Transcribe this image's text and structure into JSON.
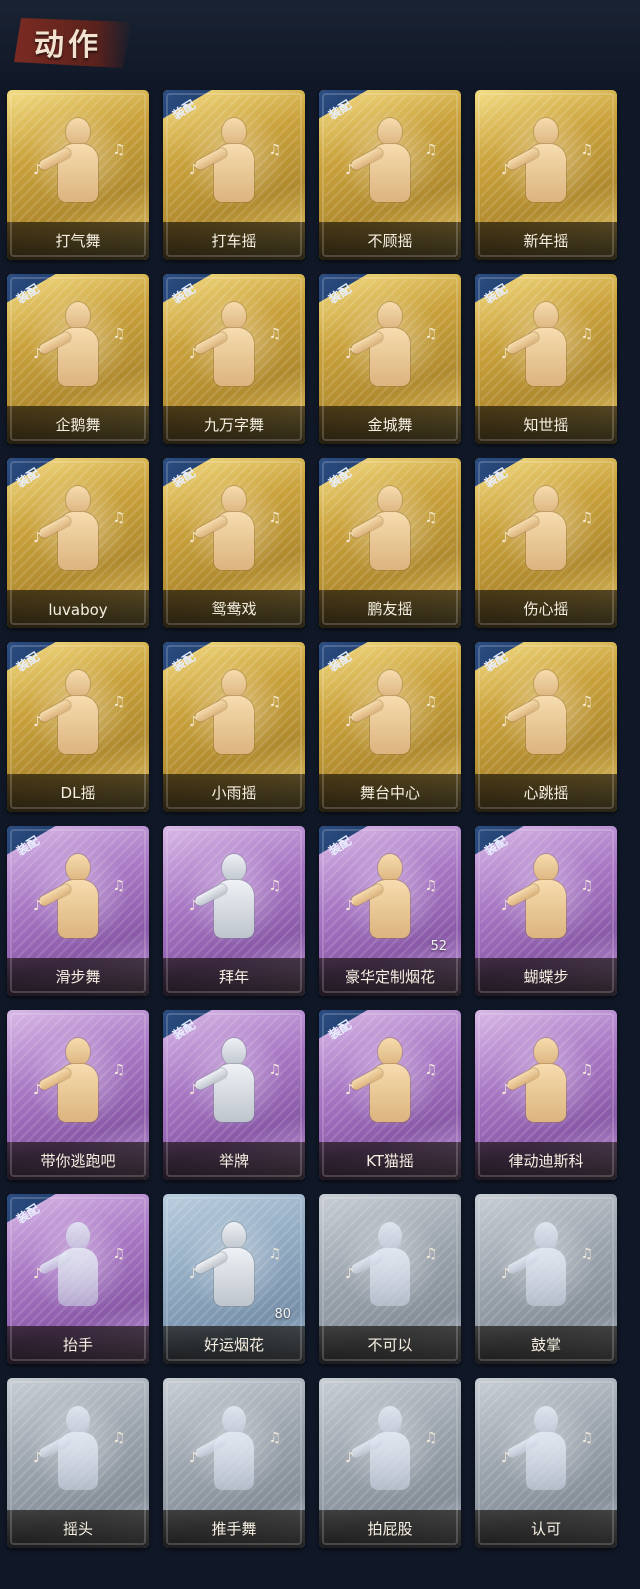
{
  "header": {
    "title": "动作"
  },
  "equip_label": "装配",
  "items": [
    {
      "label": "打气舞",
      "rarity": "gold",
      "equipped": false,
      "figure": "gold"
    },
    {
      "label": "打车摇",
      "rarity": "gold",
      "equipped": true,
      "figure": "gold"
    },
    {
      "label": "不顾摇",
      "rarity": "gold",
      "equipped": true,
      "figure": "gold"
    },
    {
      "label": "新年摇",
      "rarity": "gold",
      "equipped": false,
      "figure": "gold"
    },
    {
      "label": "企鹅舞",
      "rarity": "gold",
      "equipped": true,
      "figure": "gold"
    },
    {
      "label": "九万字舞",
      "rarity": "gold",
      "equipped": true,
      "figure": "gold"
    },
    {
      "label": "金城舞",
      "rarity": "gold",
      "equipped": true,
      "figure": "gold"
    },
    {
      "label": "知世摇",
      "rarity": "gold",
      "equipped": true,
      "figure": "gold"
    },
    {
      "label": "luvaboy",
      "rarity": "gold",
      "equipped": true,
      "figure": "gold"
    },
    {
      "label": "鸳鸯戏",
      "rarity": "gold",
      "equipped": true,
      "figure": "gold"
    },
    {
      "label": "鹏友摇",
      "rarity": "gold",
      "equipped": true,
      "figure": "gold"
    },
    {
      "label": "伤心摇",
      "rarity": "gold",
      "equipped": true,
      "figure": "gold"
    },
    {
      "label": "DL摇",
      "rarity": "gold",
      "equipped": true,
      "figure": "gold"
    },
    {
      "label": "小雨摇",
      "rarity": "gold",
      "equipped": true,
      "figure": "gold"
    },
    {
      "label": "舞台中心",
      "rarity": "gold",
      "equipped": true,
      "figure": "gold"
    },
    {
      "label": "心跳摇",
      "rarity": "gold",
      "equipped": true,
      "figure": "gold"
    },
    {
      "label": "滑步舞",
      "rarity": "purple",
      "equipped": true,
      "figure": "gold"
    },
    {
      "label": "拜年",
      "rarity": "purple",
      "equipped": false,
      "figure": "silver"
    },
    {
      "label": "豪华定制烟花",
      "rarity": "purple",
      "equipped": true,
      "figure": "gold",
      "count": "52"
    },
    {
      "label": "蝴蝶步",
      "rarity": "purple",
      "equipped": true,
      "figure": "gold"
    },
    {
      "label": "带你逃跑吧",
      "rarity": "purple",
      "equipped": false,
      "figure": "gold"
    },
    {
      "label": "举牌",
      "rarity": "purple",
      "equipped": true,
      "figure": "silver"
    },
    {
      "label": "KT猫摇",
      "rarity": "purple",
      "equipped": true,
      "figure": "gold"
    },
    {
      "label": "律动迪斯科",
      "rarity": "purple",
      "equipped": false,
      "figure": "gold"
    },
    {
      "label": "抬手",
      "rarity": "purple",
      "equipped": true,
      "figure": "ghost"
    },
    {
      "label": "好运烟花",
      "rarity": "blue",
      "equipped": false,
      "figure": "silver",
      "count": "80"
    },
    {
      "label": "不可以",
      "rarity": "grey",
      "equipped": false,
      "figure": "ghost"
    },
    {
      "label": "鼓掌",
      "rarity": "grey",
      "equipped": false,
      "figure": "ghost"
    },
    {
      "label": "摇头",
      "rarity": "grey",
      "equipped": false,
      "figure": "ghost"
    },
    {
      "label": "推手舞",
      "rarity": "grey",
      "equipped": false,
      "figure": "ghost"
    },
    {
      "label": "拍屁股",
      "rarity": "grey",
      "equipped": false,
      "figure": "ghost"
    },
    {
      "label": "认可",
      "rarity": "grey",
      "equipped": false,
      "figure": "ghost"
    }
  ]
}
